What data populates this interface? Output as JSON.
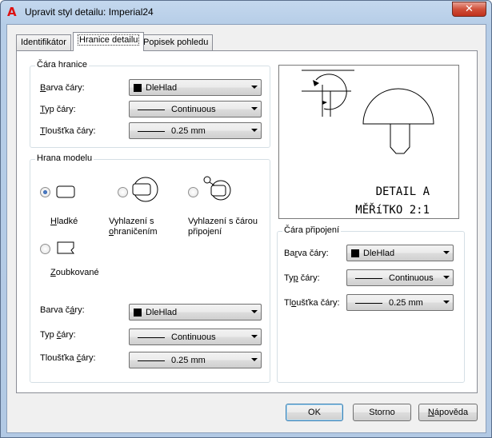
{
  "window": {
    "title": "Upravit styl detailu: Imperial24",
    "close_glyph": "✕",
    "app_icon_glyph": "A"
  },
  "tabs": [
    {
      "label": "Identifikátor",
      "active": false
    },
    {
      "label": "Hranice detailu",
      "active": true
    },
    {
      "label": "Popisek pohledu",
      "active": false
    }
  ],
  "boundary_line": {
    "title": "Čára hranice",
    "color": {
      "label_u": "B",
      "label_rest": "arva čáry:",
      "value": "DleHlad"
    },
    "type": {
      "label_u": "T",
      "label_rest": "yp čáry:",
      "value": "Continuous"
    },
    "weight": {
      "label_u": "T",
      "label_rest": "loušťka čáry:",
      "value": "0.25 mm"
    }
  },
  "model_edge": {
    "title": "Hrana modelu",
    "options": [
      {
        "label_u": "H",
        "label_rest": "ladké",
        "checked": true
      },
      {
        "label_l1": "Vyhlazení s",
        "label_l2_u": "o",
        "label_l2_rest": "hraničením",
        "checked": false
      },
      {
        "label_l1": "Vyhlazení s čárou",
        "label_l2": "připojení",
        "checked": false
      },
      {
        "label_u": "Z",
        "label_rest": "oubkované",
        "checked": false
      }
    ],
    "color": {
      "label_pre": "Barva č",
      "label_u": "á",
      "label_rest": "ry:",
      "value": "DleHlad"
    },
    "type": {
      "label_pre": "Typ ",
      "label_u": "č",
      "label_rest": "áry:",
      "value": "Continuous"
    },
    "weight": {
      "label_pre": "Tloušťka ",
      "label_u": "č",
      "label_rest": "áry:",
      "value": "0.25 mm"
    }
  },
  "preview": {
    "line1": "DETAIL A",
    "line2": "MĚŘíTKO 2:1"
  },
  "connection_line": {
    "title": "Čára připojení",
    "color": {
      "label_pre": "Ba",
      "label_u": "r",
      "label_rest": "va čáry:",
      "value": "DleHlad"
    },
    "type": {
      "label_pre": "Ty",
      "label_u": "p",
      "label_rest": " čáry:",
      "value": "Continuous"
    },
    "weight": {
      "label_pre": "Tl",
      "label_u": "o",
      "label_rest": "ušťka čáry:",
      "value": "0.25 mm"
    }
  },
  "buttons": {
    "ok": "OK",
    "cancel": "Storno",
    "help_u": "N",
    "help_rest": "ápověda"
  }
}
